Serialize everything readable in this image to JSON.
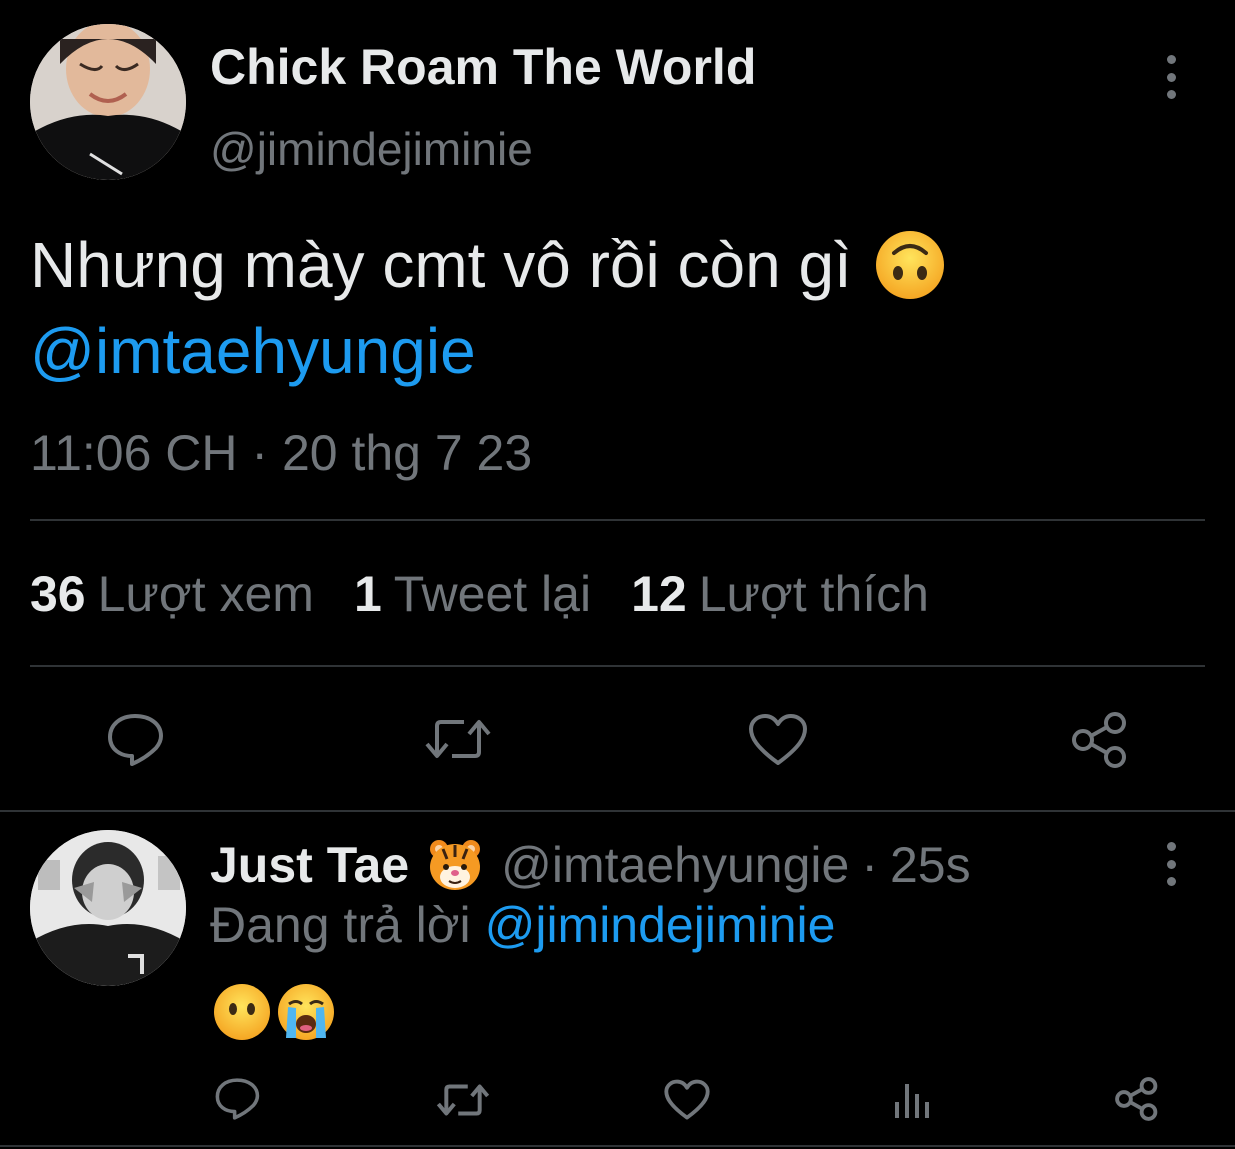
{
  "main_tweet": {
    "display_name": "Chick Roam The World",
    "handle": "@jimindejiminie",
    "text_line1": "Nhưng mày cmt vô rồi còn gì",
    "text_emoji": "upside-down-face",
    "text_mention": "@imtaehyungie",
    "timestamp": "11:06 CH · 20 thg 7 23",
    "stats": {
      "views_count": "36",
      "views_label": "Lượt xem",
      "retweets_count": "1",
      "retweets_label": "Tweet lại",
      "likes_count": "12",
      "likes_label": "Lượt thích"
    },
    "actions": [
      "reply-icon",
      "retweet-icon",
      "like-icon",
      "share-icon"
    ]
  },
  "reply": {
    "display_name": "Just Tae",
    "name_emoji": "tiger-face",
    "handle": "@imtaehyungie",
    "separator": "·",
    "time": "25s",
    "replying_label": "Đang trả lời",
    "replying_mention": "@jimindejiminie",
    "emojis": [
      "face-without-mouth",
      "loudly-crying-face"
    ],
    "actions": [
      "reply-icon",
      "retweet-icon",
      "like-icon",
      "analytics-icon",
      "share-icon"
    ]
  },
  "colors": {
    "background": "#000000",
    "text": "#e7e9ea",
    "secondary": "#71767b",
    "accent": "#1d9bf0",
    "divider": "#2f3336"
  }
}
